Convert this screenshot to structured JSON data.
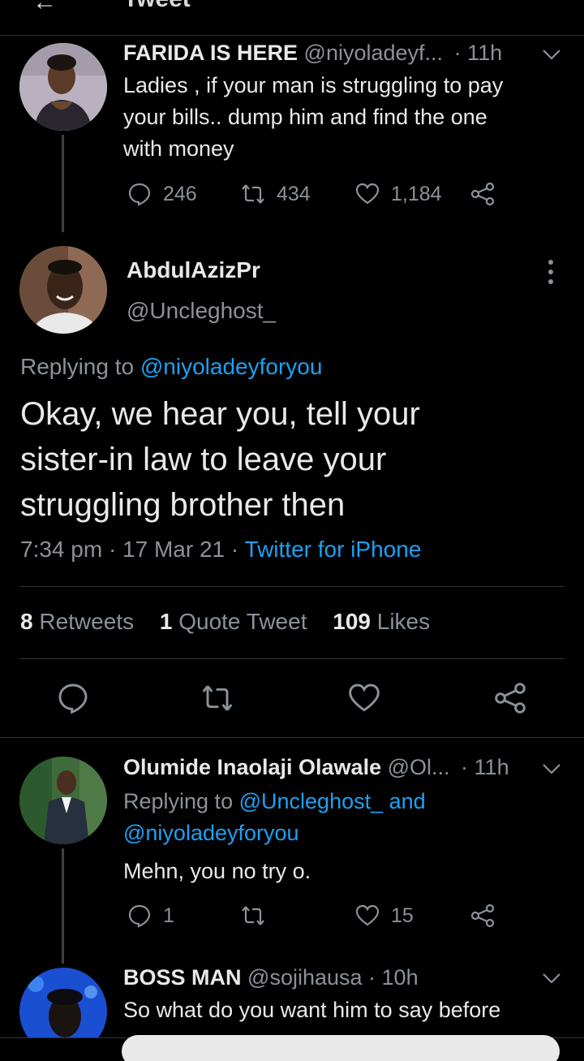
{
  "header": {
    "back_glyph": "←",
    "title": "Tweet"
  },
  "tweets": [
    {
      "name": "FARIDA IS HERE",
      "handle": "@niyoladeyf...",
      "time": "· 11h",
      "text_lines": [
        "Ladies , if your man is struggling to pay",
        "your bills.. dump him and find the one",
        "with money"
      ],
      "replies": "246",
      "retweets": "434",
      "likes": "1,184"
    },
    {
      "name": "Olumide Inaolaji Olawale",
      "handle": "@Ol...",
      "time": "· 11h",
      "replying_label": "Replying to",
      "replying_line1": "@Uncleghost_ and",
      "replying_line2": "@niyoladeyforyou",
      "text": "Mehn,  you no try o.",
      "replies": "1",
      "retweets": "",
      "likes": "15"
    },
    {
      "name": "BOSS MAN",
      "handle": "@sojihausa",
      "time": "· 10h",
      "text": "So what do you want him to say before"
    }
  ],
  "main_tweet": {
    "name": "AbdulAzizPr",
    "handle": "@Uncleghost_",
    "replying_label": "Replying to",
    "replying_handle": "@niyoladeyforyou",
    "text_lines": [
      "Okay, we hear you, tell your",
      "sister-in law to leave your",
      "struggling brother then"
    ],
    "timestamp": "7:34 pm · 17 Mar 21 ·",
    "source": "Twitter for iPhone",
    "retweets_count": "8",
    "retweets_label": "Retweets",
    "quotes_count": "1",
    "quotes_label": "Quote Tweet",
    "likes_count": "109",
    "likes_label": "Likes"
  },
  "icons": {
    "reply": "reply-icon",
    "retweet": "retweet-icon",
    "like": "heart-icon",
    "share": "share-icon",
    "more": "more-vertical-icon",
    "caret": "chevron-down-icon"
  },
  "colors": {
    "background": "#000000",
    "accent": "#1da1f2",
    "muted": "#8b9298",
    "text": "#e7e9ea"
  }
}
